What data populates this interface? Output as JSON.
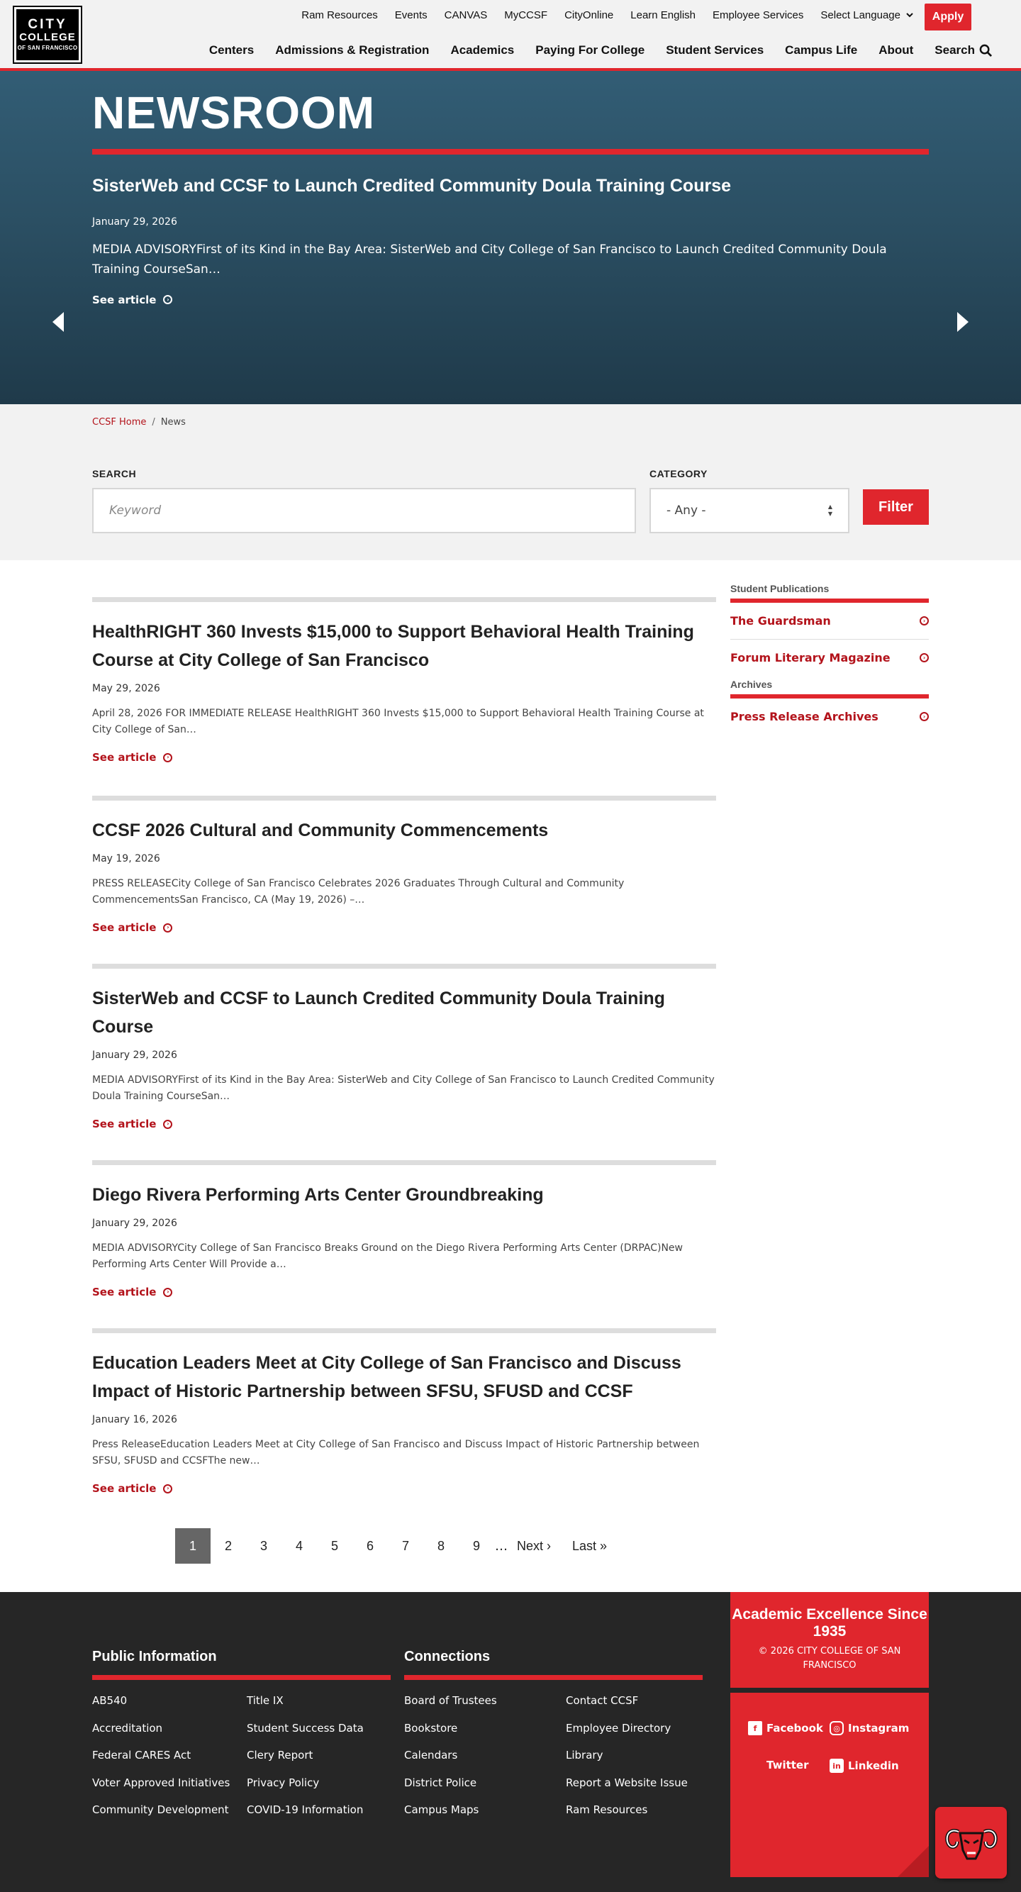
{
  "header": {
    "logo": {
      "line1": "CITY",
      "line2": "COLLEGE",
      "line3": "OF SAN FRANCISCO"
    },
    "utility_nav": [
      "Ram Resources",
      "Events",
      "CANVAS",
      "MyCCSF",
      "CityOnline",
      "Learn English",
      "Employee Services"
    ],
    "language_label": "Select Language",
    "apply_label": "Apply",
    "main_nav": [
      "Centers",
      "Admissions & Registration",
      "Academics",
      "Paying For College",
      "Student Services",
      "Campus Life",
      "About"
    ],
    "search_label": "Search"
  },
  "hero": {
    "title": "NEWSROOM",
    "headline": "SisterWeb and CCSF to Launch Credited Community Doula Training Course",
    "date": "January 29, 2026",
    "summary": "MEDIA ADVISORYFirst of its Kind in the Bay Area: SisterWeb and City College of San Francisco to Launch Credited Community Doula Training CourseSan…",
    "see_article": "See article",
    "slides_total": 3,
    "active_slide": 3
  },
  "breadcrumb": {
    "home": "CCSF Home",
    "current": "News"
  },
  "search": {
    "keyword_label": "SEARCH",
    "keyword_placeholder": "Keyword",
    "category_label": "CATEGORY",
    "category_value": "- Any -",
    "filter_label": "Filter"
  },
  "articles": [
    {
      "title": "HealthRIGHT 360 Invests $15,000 to Support Behavioral Health Training Course at City College of San Francisco",
      "date": "May 29, 2026",
      "excerpt": "April 28, 2026 FOR IMMEDIATE RELEASE HealthRIGHT 360 Invests $15,000 to Support Behavioral Health Training Course at City College of San…",
      "link": "See article"
    },
    {
      "title": "CCSF 2026 Cultural and Community Commencements",
      "date": "May 19, 2026",
      "excerpt": "PRESS RELEASECity College of San Francisco Celebrates 2026 Graduates Through Cultural and Community CommencementsSan Francisco, CA (May 19, 2026) –…",
      "link": "See article"
    },
    {
      "title": "SisterWeb and CCSF to Launch Credited Community Doula Training Course",
      "date": "January 29, 2026",
      "excerpt": "MEDIA ADVISORYFirst of its Kind in the Bay Area: SisterWeb and City College of San Francisco to Launch Credited Community Doula Training CourseSan…",
      "link": "See article"
    },
    {
      "title": "Diego Rivera Performing Arts Center Groundbreaking",
      "date": "January 29, 2026",
      "excerpt": "MEDIA ADVISORYCity College of San Francisco Breaks Ground on the Diego Rivera Performing Arts Center (DRPAC)New Performing Arts Center Will Provide a…",
      "link": "See article"
    },
    {
      "title": "Education Leaders Meet at City College of San Francisco and Discuss Impact of Historic Partnership between SFSU, SFUSD and CCSF",
      "date": "January 16, 2026",
      "excerpt": "Press ReleaseEducation Leaders Meet at City College of San Francisco and Discuss Impact of Historic Partnership between SFSU, SFUSD and CCSFThe new…",
      "link": "See article"
    }
  ],
  "pagination": {
    "pages": [
      "1",
      "2",
      "3",
      "4",
      "5",
      "6",
      "7",
      "8",
      "9"
    ],
    "current": "1",
    "ellipsis": "…",
    "next": "Next ›",
    "last": "Last »"
  },
  "sidebar": {
    "publications_heading": "Student Publications",
    "publications": [
      "The Guardsman",
      "Forum Literary Magazine"
    ],
    "archives_heading": "Archives",
    "archives": [
      "Press Release Archives"
    ]
  },
  "footer": {
    "public_info_heading": "Public Information",
    "public_info_links": [
      "AB540",
      "Title IX",
      "Accreditation",
      "Student Success Data",
      "Federal CARES Act",
      "Clery Report",
      "Voter Approved Initiatives",
      "Privacy Policy",
      "Community Development",
      "COVID-19 Information"
    ],
    "connections_heading": "Connections",
    "connections_links": [
      "Board of Trustees",
      "Contact CCSF",
      "Bookstore",
      "Employee Directory",
      "Calendars",
      "Library",
      "District Police",
      "Report a Website Issue",
      "Campus Maps",
      "Ram Resources"
    ],
    "tagline": "Academic Excellence Since 1935",
    "copyright": "© 2026 CITY COLLEGE OF SAN FRANCISCO",
    "social": [
      "Facebook",
      "Instagram",
      "Twitter",
      "Linkedin"
    ]
  },
  "colors": {
    "brand_red": "#e0262d",
    "link_red": "#b3131b",
    "hero_blue": "#2b4f63",
    "footer_dark": "#262626"
  }
}
